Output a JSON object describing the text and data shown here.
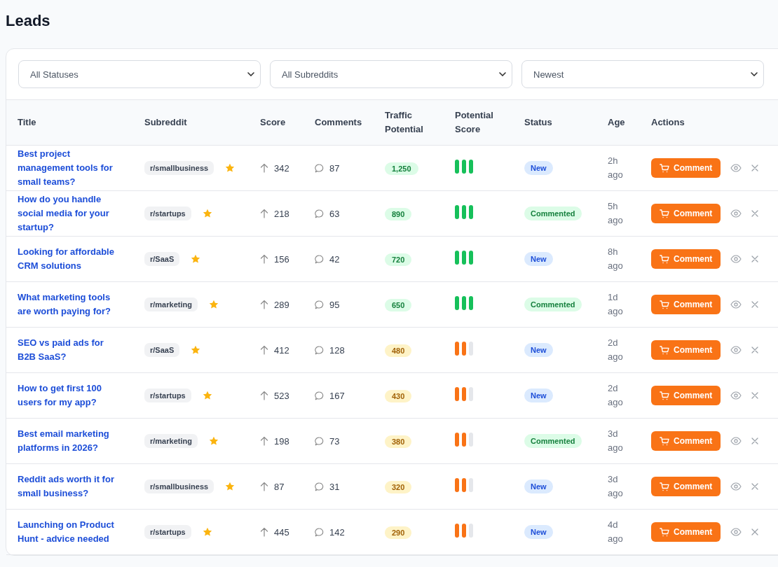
{
  "page_title": "Leads",
  "filters": [
    {
      "value": "All Statuses"
    },
    {
      "value": "All Subreddits"
    },
    {
      "value": "Newest"
    }
  ],
  "table": {
    "columns": [
      "Title",
      "Subreddit",
      "Score",
      "Comments",
      "Traffic Potential",
      "Potential Score",
      "Status",
      "Age",
      "Actions"
    ],
    "rows": [
      {
        "title": "Best project management tools for small teams?",
        "subreddit": "r/smallbusiness",
        "starred": true,
        "score": "342",
        "comments": "87",
        "traffic": "1,250",
        "color": "#16c05a",
        "level": 1,
        "status": {
          "kind": "new",
          "label": "New"
        },
        "age": "2h ago",
        "action": "Comment"
      },
      {
        "title": "How do you handle social media for your startup?",
        "subreddit": "r/startups",
        "starred": true,
        "score": "218",
        "comments": "63",
        "traffic": "890",
        "color": "#16c05a",
        "level": 1,
        "status": {
          "kind": "commented",
          "label": "Commented"
        },
        "age": "5h ago",
        "action": "Comment"
      },
      {
        "title": "Looking for affordable CRM solutions",
        "subreddit": "r/SaaS",
        "starred": true,
        "score": "156",
        "comments": "42",
        "traffic": "720",
        "color": "#16c05a",
        "level": 1,
        "status": {
          "kind": "new",
          "label": "New"
        },
        "age": "8h ago",
        "action": "Comment"
      },
      {
        "title": "What marketing tools are worth paying for?",
        "subreddit": "r/marketing",
        "starred": true,
        "score": "289",
        "comments": "95",
        "traffic": "650",
        "color": "#16c05a",
        "level": 1,
        "status": {
          "kind": "commented",
          "label": "Commented"
        },
        "age": "1d ago",
        "action": "Comment"
      },
      {
        "title": "SEO vs paid ads for B2B SaaS?",
        "subreddit": "r/SaaS",
        "starred": true,
        "score": "412",
        "comments": "128",
        "traffic": "480",
        "color": "#f97316",
        "level": 0.67,
        "status": {
          "kind": "new",
          "label": "New"
        },
        "age": "2d ago",
        "action": "Comment"
      },
      {
        "title": "How to get first 100 users for my app?",
        "subreddit": "r/startups",
        "starred": true,
        "score": "523",
        "comments": "167",
        "traffic": "430",
        "color": "#f97316",
        "level": 0.67,
        "status": {
          "kind": "new",
          "label": "New"
        },
        "age": "2d ago",
        "action": "Comment"
      },
      {
        "title": "Best email marketing platforms in 2026?",
        "subreddit": "r/marketing",
        "starred": true,
        "score": "198",
        "comments": "73",
        "traffic": "380",
        "color": "#f97316",
        "level": 0.67,
        "status": {
          "kind": "commented",
          "label": "Commented"
        },
        "age": "3d ago",
        "action": "Comment"
      },
      {
        "title": "Reddit ads worth it for small business?",
        "subreddit": "r/smallbusiness",
        "starred": true,
        "score": "87",
        "comments": "31",
        "traffic": "320",
        "color": "#f97316",
        "level": 0.67,
        "status": {
          "kind": "new",
          "label": "New"
        },
        "age": "3d ago",
        "action": "Comment"
      },
      {
        "title": "Launching on Product Hunt - advice needed",
        "subreddit": "r/startups",
        "starred": true,
        "score": "445",
        "comments": "142",
        "traffic": "290",
        "color": "#f97316",
        "level": 0.67,
        "status": {
          "kind": "new",
          "label": "New"
        },
        "age": "4d ago",
        "action": "Comment"
      }
    ]
  }
}
